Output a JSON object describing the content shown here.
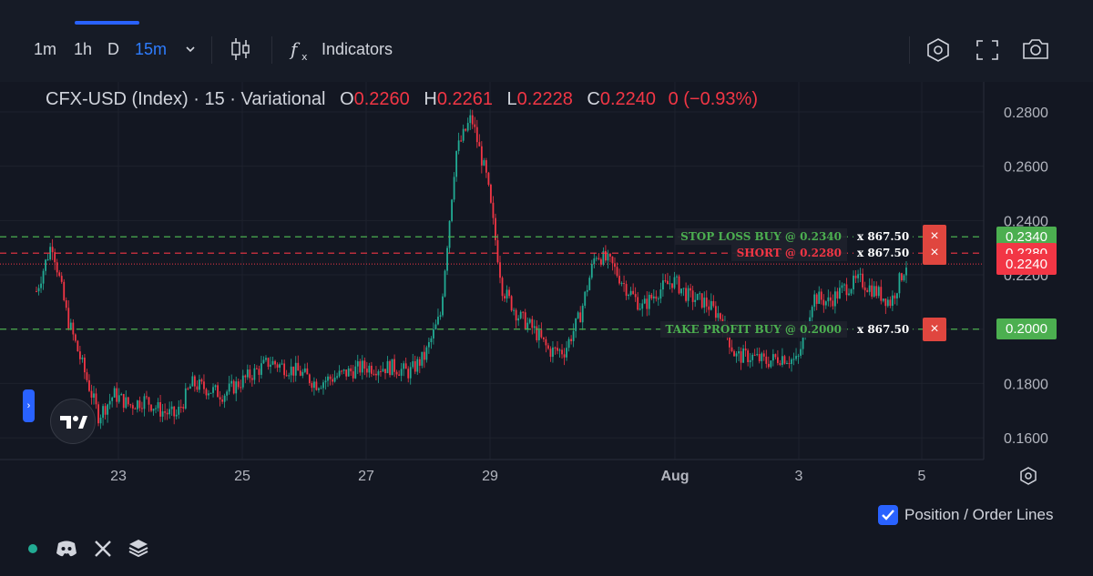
{
  "toolbar": {
    "timeframes": [
      "1m",
      "1h",
      "D",
      "15m"
    ],
    "active_timeframe": "15m",
    "indicators_label": "Indicators"
  },
  "legend": {
    "symbol": "CFX-USD (Index) · 15 · Variational",
    "open_label": "O",
    "open": "0.2260",
    "high_label": "H",
    "high": "0.2261",
    "low_label": "L",
    "low": "0.2228",
    "close_label": "C",
    "close": "0.2240",
    "change": "0 (−0.93%)"
  },
  "price_axis": [
    "0.2800",
    "0.2600",
    "0.2400",
    "0.2200",
    "0.2000",
    "0.1800",
    "0.1600"
  ],
  "time_axis": [
    "23",
    "25",
    "27",
    "29",
    "Aug",
    "3",
    "5"
  ],
  "orders": [
    {
      "label": "STOP LOSS BUY @ 0.2340",
      "qty": "x 867.50",
      "price": "0.2340",
      "color": "#4caf50"
    },
    {
      "label": "SHORT @ 0.2280",
      "qty": "x 867.50",
      "price": "0.2280",
      "color": "#f23645"
    },
    {
      "label": "TAKE PROFIT BUY @ 0.2000",
      "qty": "x 867.50",
      "price": "0.2000",
      "color": "#4caf50"
    }
  ],
  "current_price": "0.2240",
  "bottom": {
    "position_lines_label": "Position / Order Lines",
    "position_lines_checked": true
  },
  "colors": {
    "up": "#22ab94",
    "down": "#f23645",
    "accent": "#2962ff"
  },
  "chart_data": {
    "type": "candlestick",
    "x": [
      "22 12:00",
      "22 18:00",
      "23 00:00",
      "23 06:00",
      "23 12:00",
      "23 18:00",
      "24 00:00",
      "24 06:00",
      "24 12:00",
      "24 18:00",
      "25 00:00",
      "25 06:00",
      "25 12:00",
      "25 18:00",
      "26 00:00",
      "26 06:00",
      "26 12:00",
      "26 18:00",
      "27 00:00",
      "27 06:00",
      "27 12:00",
      "27 18:00",
      "28 00:00",
      "28 06:00",
      "28 12:00",
      "28 18:00",
      "29 00:00",
      "29 06:00",
      "29 09:00",
      "29 12:00",
      "29 15:00",
      "29 18:00",
      "30 00:00",
      "30 06:00",
      "30 12:00",
      "30 18:00",
      "31 00:00",
      "31 03:00",
      "31 06:00",
      "31 12:00",
      "31 18:00",
      "Aug 1 00:00",
      "Aug 1 06:00",
      "Aug 1 12:00",
      "Aug 1 18:00",
      "Aug 2 00:00",
      "Aug 2 06:00",
      "Aug 2 12:00",
      "Aug 2 18:00",
      "Aug 3 00:00",
      "Aug 3 06:00",
      "Aug 3 12:00",
      "Aug 3 18:00",
      "Aug 4 00:00",
      "Aug 4 06:00",
      "Aug 4 12:00",
      "Aug 4 18:00"
    ],
    "close": [
      0.214,
      0.232,
      0.204,
      0.186,
      0.168,
      0.176,
      0.172,
      0.174,
      0.17,
      0.168,
      0.18,
      0.178,
      0.176,
      0.18,
      0.184,
      0.188,
      0.186,
      0.184,
      0.18,
      0.182,
      0.184,
      0.186,
      0.186,
      0.186,
      0.184,
      0.19,
      0.205,
      0.265,
      0.278,
      0.255,
      0.215,
      0.205,
      0.2,
      0.192,
      0.192,
      0.205,
      0.228,
      0.224,
      0.215,
      0.208,
      0.214,
      0.218,
      0.212,
      0.21,
      0.205,
      0.19,
      0.19,
      0.188,
      0.19,
      0.188,
      0.212,
      0.21,
      0.215,
      0.218,
      0.214,
      0.21,
      0.224
    ],
    "ylim": [
      0.152,
      0.281
    ]
  }
}
